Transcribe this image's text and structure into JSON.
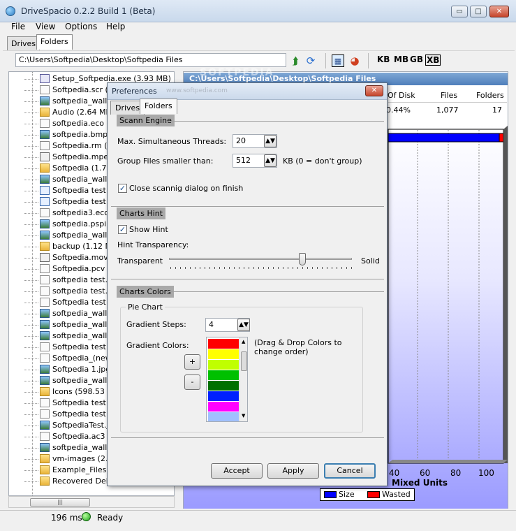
{
  "window": {
    "title": "DriveSpacio 0.2.2 Build 1 (Beta)",
    "controls": {
      "minimize": "▭",
      "maximize": "□",
      "close": "✕"
    }
  },
  "menu": [
    "File",
    "View",
    "Options",
    "Help"
  ],
  "main_tabs": [
    {
      "label": "Drives",
      "active": false
    },
    {
      "label": "Folders",
      "active": true
    }
  ],
  "toolbar": {
    "path": "C:\\Users\\Softpedia\\Desktop\\Softpedia Files",
    "units": [
      "KB",
      "MB",
      "GB",
      "XB"
    ],
    "active_unit": "XB"
  },
  "tree": {
    "items": [
      {
        "label": "Setup_Softpedia.exe (3.93 MB)",
        "icon": "exe-icon"
      },
      {
        "label": "Softpedia.scr (3",
        "icon": "file-icon"
      },
      {
        "label": "softpedia_wallp",
        "icon": "image-icon"
      },
      {
        "label": "Audio (2.64 MB)",
        "icon": "folder-icon"
      },
      {
        "label": "softpedia.eco (2",
        "icon": "file-icon"
      },
      {
        "label": "softpedia.bmp (2",
        "icon": "image-icon"
      },
      {
        "label": "Softpedia.rm (2",
        "icon": "file-icon"
      },
      {
        "label": "Softpedia.mpeg",
        "icon": "video-icon"
      },
      {
        "label": "Softpedia (1.77",
        "icon": "folder-icon"
      },
      {
        "label": "softpedia_wallp",
        "icon": "image-icon"
      },
      {
        "label": "Softpedia test.w",
        "icon": "audio-icon"
      },
      {
        "label": "Softpedia test.a",
        "icon": "audio-icon"
      },
      {
        "label": "softpedia3.eco (",
        "icon": "file-icon"
      },
      {
        "label": "softpedia.pspim",
        "icon": "image-icon"
      },
      {
        "label": "softpedia_wallp",
        "icon": "image-icon"
      },
      {
        "label": "backup (1.12 MB",
        "icon": "folder-icon"
      },
      {
        "label": "Softpedia.mov (",
        "icon": "video-icon"
      },
      {
        "label": "Softpedia.pcv (1",
        "icon": "file-icon"
      },
      {
        "label": "softpedia test.m",
        "icon": "file-icon"
      },
      {
        "label": "softpedia test.s",
        "icon": "file-icon"
      },
      {
        "label": "Softpedia test.b",
        "icon": "file-icon"
      },
      {
        "label": "softpedia_wallp",
        "icon": "image-icon"
      },
      {
        "label": "softpedia_wallp",
        "icon": "image-icon"
      },
      {
        "label": "softpedia_wallp",
        "icon": "image-icon"
      },
      {
        "label": "Softpedia test.a",
        "icon": "file-icon"
      },
      {
        "label": "Softpedia_(new",
        "icon": "file-icon"
      },
      {
        "label": "Softpedia 1.jpg",
        "icon": "image-icon"
      },
      {
        "label": "softpedia_wallp",
        "icon": "image-icon"
      },
      {
        "label": "Icons (598.53 K",
        "icon": "folder-icon"
      },
      {
        "label": "Softpedia test.p",
        "icon": "file-icon"
      },
      {
        "label": "Softpedia test.p",
        "icon": "file-icon"
      },
      {
        "label": "SoftpediaTest.jp",
        "icon": "image-icon"
      },
      {
        "label": "Softpedia.ac3 (5",
        "icon": "file-icon"
      },
      {
        "label": "softpedia_wallp",
        "icon": "image-icon"
      },
      {
        "label": "vm-images (2.69",
        "icon": "folder-icon"
      },
      {
        "label": "Example_Files (9",
        "icon": "folder-icon"
      },
      {
        "label": "Recovered Delet",
        "icon": "folder-icon"
      }
    ]
  },
  "right_panel": {
    "path_header": "C:\\Users\\Softpedia\\Desktop\\Softpedia Files",
    "watermark": "SOFTPEDIA",
    "columns": [
      "Of Disk",
      "Files",
      "Folders"
    ],
    "row": {
      "of_disk": "0.44%",
      "files": "1,077",
      "folders": "17"
    },
    "chart": {
      "x_ticks": [
        "40",
        "60",
        "80",
        "100"
      ],
      "x_label": "Mixed Units",
      "legend": [
        {
          "name": "Size",
          "color": "#0000ff"
        },
        {
          "name": "Wasted",
          "color": "#ff0000"
        }
      ]
    }
  },
  "status": {
    "time": "196 ms",
    "state": "Ready"
  },
  "dialog": {
    "title": "Preferences",
    "watermark": "www.softpedia.com",
    "tabs": [
      {
        "label": "Drives",
        "active": false
      },
      {
        "label": "Folders",
        "active": true
      }
    ],
    "scan_engine": {
      "header": "Scann Engine",
      "threads_label": "Max. Simultaneous Threads:",
      "threads_value": "20",
      "group_label": "Group Files smaller than:",
      "group_value": "512",
      "group_unit": "KB (0 = don't group)",
      "close_label": "Close scannig dialog on finish",
      "close_checked": true
    },
    "charts_hint": {
      "header": "Charts Hint",
      "show_label": "Show Hint",
      "show_checked": true,
      "transparency_label": "Hint Transparency:",
      "left_label": "Transparent",
      "right_label": "Solid",
      "value": 0.73
    },
    "charts_colors": {
      "header": "Charts Colors",
      "pie_header": "Pie Chart",
      "steps_label": "Gradient Steps:",
      "steps_value": "4",
      "colors_label": "Gradient Colors:",
      "note": "(Drag & Drop Colors to change order)",
      "plus": "+",
      "minus": "-",
      "colors": [
        "#ff0000",
        "#ffff00",
        "#c0ff00",
        "#00c000",
        "#007000",
        "#0020ff",
        "#ff00ff",
        "#a0c0ff"
      ]
    },
    "buttons": {
      "accept": "Accept",
      "apply": "Apply",
      "cancel": "Cancel"
    }
  }
}
